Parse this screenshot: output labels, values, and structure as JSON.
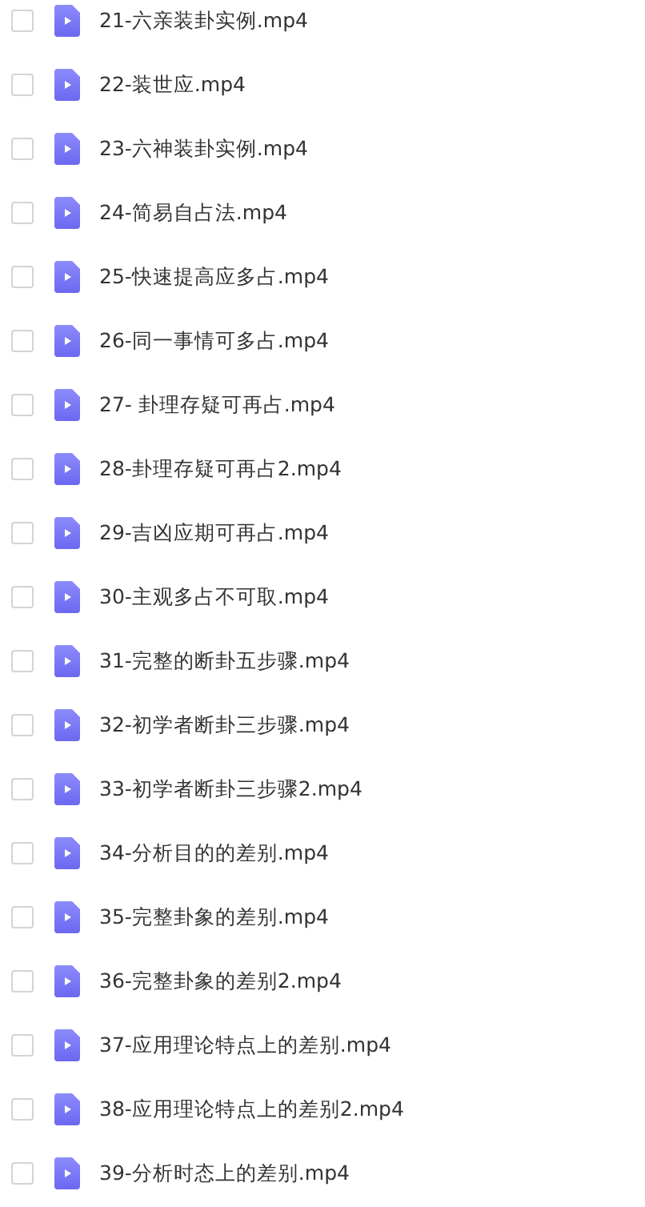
{
  "files": [
    {
      "name": "21-六亲装卦实例.mp4",
      "checked": false
    },
    {
      "name": "22-装世应.mp4",
      "checked": false
    },
    {
      "name": "23-六神装卦实例.mp4",
      "checked": false
    },
    {
      "name": "24-简易自占法.mp4",
      "checked": false
    },
    {
      "name": "25-快速提高应多占.mp4",
      "checked": false
    },
    {
      "name": "26-同一事情可多占.mp4",
      "checked": false
    },
    {
      "name": "27- 卦理存疑可再占.mp4",
      "checked": false
    },
    {
      "name": "28-卦理存疑可再占2.mp4",
      "checked": false
    },
    {
      "name": "29-吉凶应期可再占.mp4",
      "checked": false
    },
    {
      "name": "30-主观多占不可取.mp4",
      "checked": false
    },
    {
      "name": "31-完整的断卦五步骤.mp4",
      "checked": false
    },
    {
      "name": "32-初学者断卦三步骤.mp4",
      "checked": false
    },
    {
      "name": "33-初学者断卦三步骤2.mp4",
      "checked": false
    },
    {
      "name": "34-分析目的的差别.mp4",
      "checked": false
    },
    {
      "name": "35-完整卦象的差别.mp4",
      "checked": false
    },
    {
      "name": "36-完整卦象的差别2.mp4",
      "checked": false
    },
    {
      "name": "37-应用理论特点上的差别.mp4",
      "checked": false
    },
    {
      "name": "38-应用理论特点上的差别2.mp4",
      "checked": false
    },
    {
      "name": "39-分析时态上的差别.mp4",
      "checked": false
    }
  ]
}
